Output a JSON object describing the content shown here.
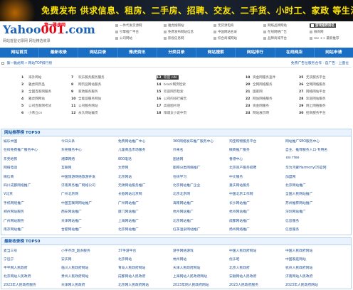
{
  "banner": {
    "text": "免费发布 供求信息、租房、二手房、招聘、交友、二手货、小时工、家政 等生活分类信息"
  },
  "logo": {
    "main": "Yahoo",
    "num": "001",
    "suffix": ".com",
    "badge": "第一雅虎网",
    "slogan": "网站首登记录网 网址精选收录"
  },
  "top_links": [
    [
      "一件代发货源网",
      "雅虎搜网站",
      "无货源电商",
      "网络品牌网站",
      "游戏推荐排名"
    ],
    [
      "引擎推广平台",
      "免费发布网站信息",
      "中国网站名录",
      "在线网络广告",
      "微商网"
    ],
    [
      "公司网站",
      "影视信息网",
      "综合商城网站",
      "品牌商城平台",
      "mx ++ 最新推荐"
    ]
  ],
  "nav": [
    "网站首页",
    "最新收录",
    "网站目录",
    "雅虎资讯",
    "分类目录",
    "网站搜索",
    "网站排行",
    "在线网店",
    "网站申请"
  ],
  "breadcrumb": {
    "home": "第一雅虎网",
    "current": "网站TOP排行榜",
    "right": "免费广告位服务合作 · 自广告 · 上面位"
  },
  "rank_list": [
    {
      "n": "1",
      "t": "海外网站"
    },
    {
      "n": "2",
      "t": "雅虎网页品"
    },
    {
      "n": "3",
      "t": "全国百家网服务"
    },
    {
      "n": "4",
      "t": "雅虎网网站"
    },
    {
      "n": "5",
      "t": "公司百家网考试"
    },
    {
      "n": "6",
      "t": "小青立cn"
    },
    {
      "n": "7",
      "t": "欢乐服务服务服务"
    },
    {
      "n": "8",
      "t": "网页品网站服务"
    },
    {
      "n": "9",
      "t": "家政服务服务"
    },
    {
      "n": "10",
      "t": "全能品服务网站"
    },
    {
      "n": "11",
      "t": "公司服务网站"
    },
    {
      "n": "12",
      "t": "永久网站编页"
    },
    {
      "n": "13",
      "t": "欢迎 cdn",
      "hl": true
    },
    {
      "n": "14",
      "t": "brazil网页检索"
    },
    {
      "n": "15",
      "t": "欢迎网页检索"
    },
    {
      "n": "16",
      "t": "公司的排行报告"
    },
    {
      "n": "17",
      "t": "高速图片吧"
    },
    {
      "n": "18",
      "t": "阳城女小说中页"
    },
    {
      "n": "19",
      "t": "资金网服务查件"
    },
    {
      "n": "20",
      "t": "全网网络服务"
    },
    {
      "n": "21",
      "t": "国家网"
    },
    {
      "n": "22",
      "t": "网站网络服务"
    },
    {
      "n": "23",
      "t": "资金网服务"
    },
    {
      "n": "24",
      "t": "网站展示网"
    },
    {
      "n": "25",
      "t": "无双服务平台"
    },
    {
      "n": "26",
      "t": "全网网络服务"
    },
    {
      "n": "27",
      "t": "网络网站平台"
    },
    {
      "n": "28",
      "t": "欢迎网站服务"
    },
    {
      "n": "29",
      "t": "网上网络服务"
    },
    {
      "n": "30",
      "t": "招商服务平台"
    }
  ],
  "section1": {
    "title": "网站推荐榜 TOP50",
    "rows": [
      [
        "娱乐中国",
        "今日头条",
        "免费网站推广中心",
        "360网络发布推广服务中心",
        "淘宝购物服务平台",
        "网站推广SEO服务中心"
      ],
      [
        "在线免费推广服务中心",
        "东莞服务中心",
        "儿童商品市场服务",
        "外来名",
        "微商推广服务",
        "自主、推荐服务入口·专用名"
      ],
      [
        "东莞地铁",
        "湘潭网络",
        "800电话",
        "国通网",
        "香港中心",
        "Toll Free"
      ],
      [
        "网络电话",
        "互联网",
        "太原网",
        "图吧分类网络推广",
        "北京资产服务招聘",
        "华为鸿蒙HarmonyOS官网"
      ],
      [
        "微信商",
        "中国旅游网络旅游开发",
        "北京网站",
        "在线学习",
        "中文服务",
        "加盟网"
      ],
      [
        "四川成都网络推广",
        "济南商务推广网络公司",
        "无锡网站服务推广",
        "北京网站推广企业",
        "重庆网站服务",
        "北京网站推广"
      ],
      [
        "V北京",
        "广州北京网",
        "长春网站北京网",
        "北京北京网",
        "中国北京工作网",
        "全国人民网站推广"
      ],
      [
        "手机网络推广",
        "中国互联网网站推广",
        "广州网站推广",
        "海南网站推广",
        "长沙网站推广",
        "苏州推荐网站推广"
      ],
      [
        "郑州网站服务",
        "西安网站推广",
        "厦门网站推广",
        "杭州网站推广",
        "杭州网站推广",
        "深圳网站推广"
      ],
      [
        "广州网站服务",
        "天津网站推广",
        "上海网站推广",
        "北京网站推广",
        "成都网站推广",
        "信息服务"
      ],
      [
        "南京网站推广",
        "合肥网站推广",
        "北京网站推广",
        "红茶温泉网站推广",
        "扬州网络推广",
        "信息服务"
      ]
    ]
  },
  "section2": {
    "title": "最新收录榜 TOP50",
    "rows": [
      [
        "麦当三号",
        "小字齐改_超多服务",
        "37手游平台",
        "游手网络游戏",
        "中国人民政府网站",
        "中国人民政府网站"
      ],
      [
        "宁远宁",
        "安庆网",
        "北京网站",
        "杭州网站",
        "优乐吧",
        "中国家庭网站"
      ],
      [
        "平平网人民政府",
        "临川人民政府网站",
        "青岛人民政府网站",
        "天津人民政府网站",
        "北京人民政府",
        "杭州人民政府网站"
      ],
      [
        "北京网站人民政府",
        "贵州人民政府网站",
        "成都网站人民政府",
        "上海网站人民政府网站",
        "安徽网站人民政府",
        "济南网站人民政府"
      ],
      [
        "2023年人民政府服务",
        "天津网人民政府",
        "北京网人民政府网站",
        "2023年网人民政府网站",
        "2023人民政府服务",
        "2023年人民政府网站"
      ]
    ]
  }
}
